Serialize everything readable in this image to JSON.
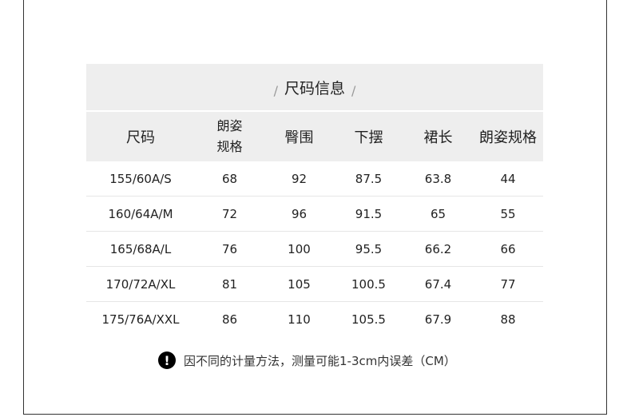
{
  "title": "尺码信息",
  "title_slash_left": "/",
  "title_slash_right": "/",
  "columns": [
    "尺码",
    "朗姿规格",
    "臀围",
    "下摆",
    "裙长",
    "朗姿规格"
  ],
  "column_wrap": {
    "line1": "朗姿",
    "line2": "规格"
  },
  "rows": [
    [
      "155/60A/S",
      "68",
      "92",
      "87.5",
      "63.8",
      "44"
    ],
    [
      "160/64A/M",
      "72",
      "96",
      "91.5",
      "65",
      "55"
    ],
    [
      "165/68A/L",
      "76",
      "100",
      "95.5",
      "66.2",
      "66"
    ],
    [
      "170/72A/XL",
      "81",
      "105",
      "100.5",
      "67.4",
      "77"
    ],
    [
      "175/76A/XXL",
      "86",
      "110",
      "105.5",
      "67.9",
      "88"
    ]
  ],
  "note": {
    "icon": "exclamation-icon",
    "icon_glyph": "!",
    "text": "因不同的计量方法，测量可能1-3cm内误差（CM）"
  }
}
